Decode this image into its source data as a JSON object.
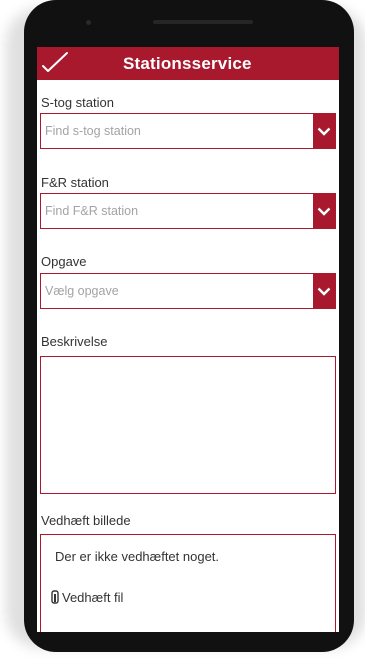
{
  "header": {
    "title": "Stationsservice"
  },
  "fields": {
    "stog": {
      "label": "S-tog station",
      "placeholder": "Find s-tog station"
    },
    "fr": {
      "label": "F&R station",
      "placeholder": "Find F&R station"
    },
    "opgave": {
      "label": "Opgave",
      "placeholder": "Vælg opgave"
    }
  },
  "description": {
    "label": "Beskrivelse"
  },
  "attachment": {
    "label": "Vedhæft billede",
    "empty_message": "Der er ikke vedhæftet noget.",
    "button_label": "Vedhæft fil"
  },
  "colors": {
    "accent": "#a8192e",
    "device": "#111111"
  },
  "icons": [
    "checkmark-icon",
    "chevron-down-icon",
    "paperclip-icon"
  ]
}
